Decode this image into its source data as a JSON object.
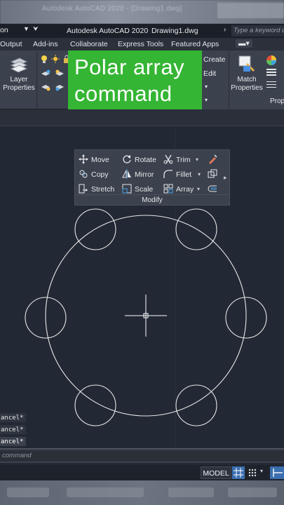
{
  "blurred_header": {
    "text": "Autodesk AutoCAD 2020 - [Drawing1.dwg]"
  },
  "titlebar": {
    "workspace": "on",
    "app_name": "Autodesk AutoCAD 2020",
    "document": "Drawing1.dwg",
    "search_placeholder": "Type a keyword or phrase"
  },
  "ribbon_tabs": [
    "Output",
    "Add-ins",
    "Collaborate",
    "Express Tools",
    "Featured Apps"
  ],
  "ribbon": {
    "layer_properties": [
      "Layer",
      "Properties"
    ],
    "create": "Create",
    "edit": "Edit",
    "match_properties": [
      "Match",
      "Properties"
    ],
    "properties_panel": "Prop"
  },
  "banner": {
    "line1": "Polar array",
    "line2": "command"
  },
  "modify_panel": {
    "title": "Modify",
    "items": {
      "move": "Move",
      "rotate": "Rotate",
      "trim": "Trim",
      "copy": "Copy",
      "mirror": "Mirror",
      "fillet": "Fillet",
      "stretch": "Stretch",
      "scale": "Scale",
      "array": "Array"
    }
  },
  "command_history": [
    "ancel*",
    "ancel*",
    "ancel*"
  ],
  "command_line": {
    "placeholder": "command"
  },
  "status_bar": {
    "model": "MODEL"
  },
  "colors": {
    "canvas": "#222834",
    "ribbon": "#3b414d",
    "banner": "#35b534",
    "accent_blue": "#3b6fb0",
    "geometry": "#e8e8e8"
  }
}
